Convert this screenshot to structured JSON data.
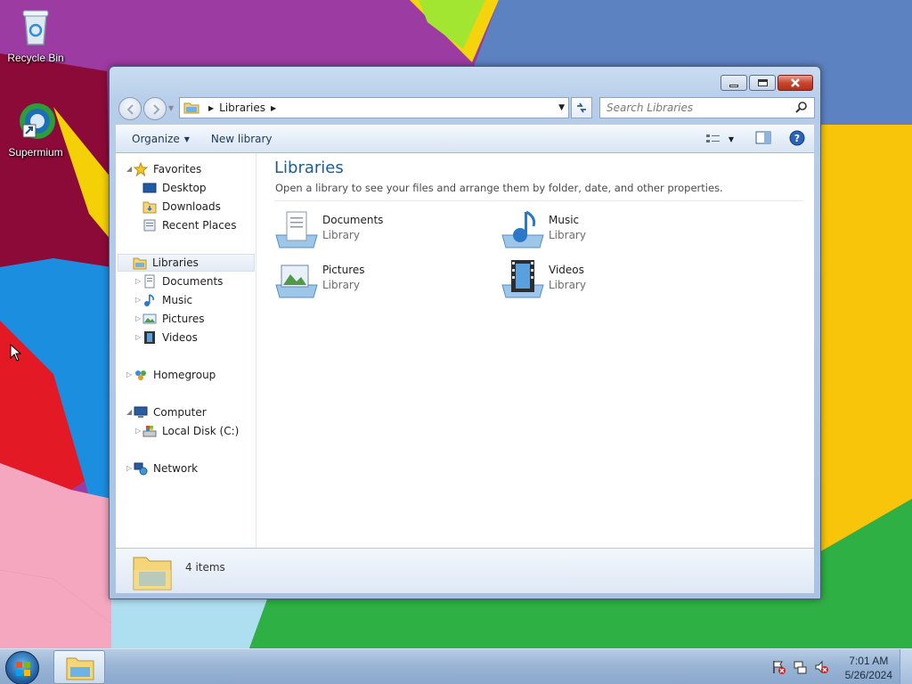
{
  "desktop": {
    "icons": [
      {
        "label": "Recycle Bin",
        "icon": "recycle-bin-icon"
      },
      {
        "label": "Supermium",
        "icon": "supermium-browser-icon"
      }
    ]
  },
  "window": {
    "title": "Libraries",
    "controls": {
      "minimize": "minimize-icon",
      "maximize": "maximize-icon",
      "close": "close-icon"
    },
    "address": {
      "segments": [
        "Libraries"
      ]
    },
    "search": {
      "placeholder": "Search Libraries"
    },
    "toolbar": {
      "organize_label": "Organize",
      "new_library_label": "New library"
    },
    "nav_pane": {
      "favorites": {
        "label": "Favorites",
        "items": [
          "Desktop",
          "Downloads",
          "Recent Places"
        ]
      },
      "libraries": {
        "label": "Libraries",
        "items": [
          "Documents",
          "Music",
          "Pictures",
          "Videos"
        ]
      },
      "homegroup": {
        "label": "Homegroup"
      },
      "computer": {
        "label": "Computer",
        "items": [
          "Local Disk (C:)"
        ]
      },
      "network": {
        "label": "Network"
      }
    },
    "content": {
      "heading": "Libraries",
      "subtitle": "Open a library to see your files and arrange them by folder, date, and other properties.",
      "libraries": [
        {
          "name": "Documents",
          "kind": "Library"
        },
        {
          "name": "Music",
          "kind": "Library"
        },
        {
          "name": "Pictures",
          "kind": "Library"
        },
        {
          "name": "Videos",
          "kind": "Library"
        }
      ]
    },
    "details": {
      "item_count": "4 items"
    }
  },
  "taskbar": {
    "clock": {
      "time": "7:01 AM",
      "date": "5/26/2024"
    }
  },
  "colors": {
    "heading": "#1e5d8f",
    "selection": "#e3ebf5",
    "taskbar": "#9ab5d5"
  }
}
